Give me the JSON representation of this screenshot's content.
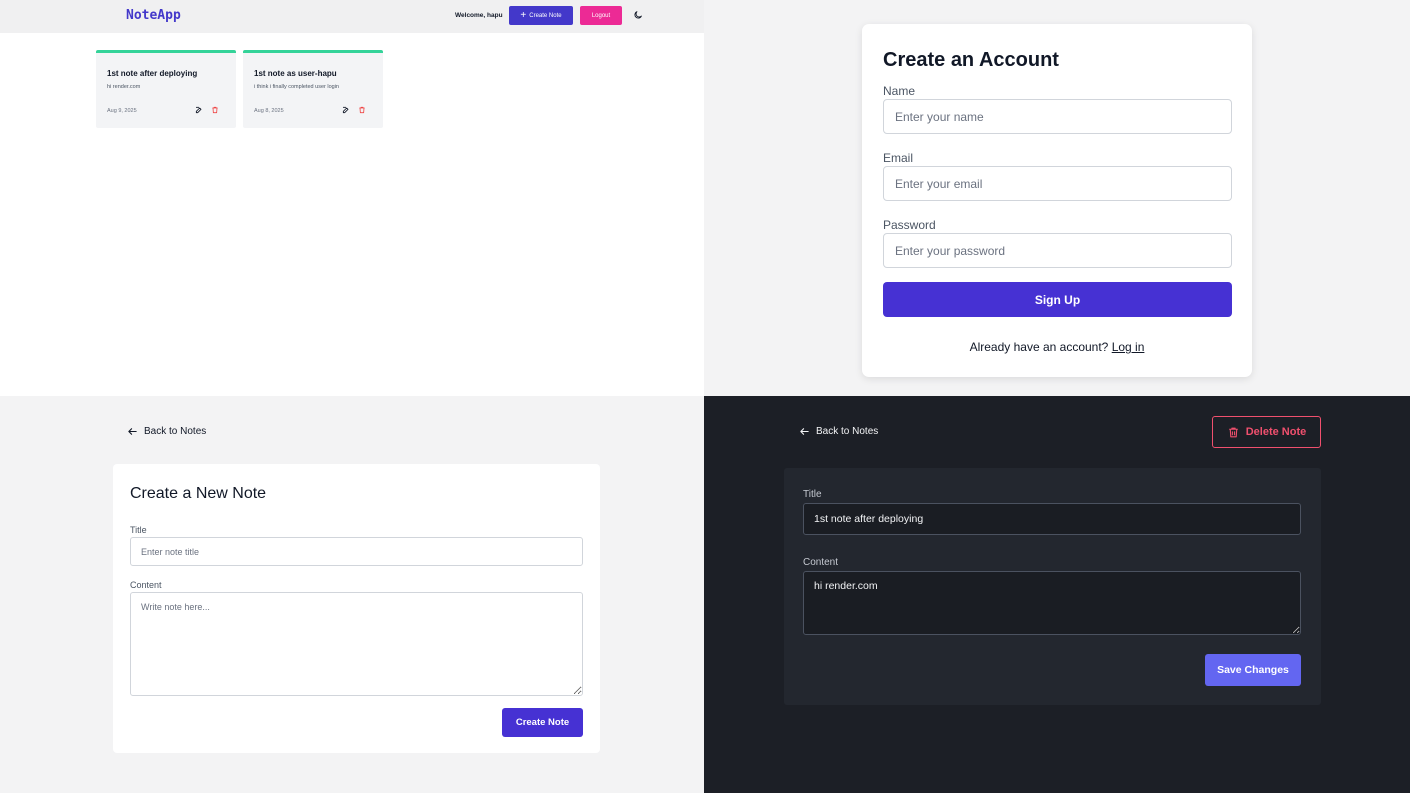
{
  "dashboard": {
    "brand": "NoteApp",
    "welcome": "Welcome, hapu",
    "create_note_label": "Create Note",
    "logout_label": "Logout",
    "notes": [
      {
        "title": "1st note after deploying",
        "content": "hi render.com",
        "date": "Aug 9, 2025"
      },
      {
        "title": "1st note as user-hapu",
        "content": "i think i finally completed user login",
        "date": "Aug 8, 2025"
      }
    ],
    "accent_color": "#34d399"
  },
  "signup": {
    "title": "Create an Account",
    "name_label": "Name",
    "name_placeholder": "Enter your name",
    "email_label": "Email",
    "email_placeholder": "Enter your email",
    "password_label": "Password",
    "password_placeholder": "Enter your password",
    "submit_label": "Sign Up",
    "footer_text": "Already have an account?",
    "login_link": "Log in"
  },
  "create_note": {
    "back_label": "Back to Notes",
    "title": "Create a New Note",
    "title_label": "Title",
    "title_placeholder": "Enter note title",
    "content_label": "Content",
    "content_placeholder": "Write note here...",
    "submit_label": "Create Note"
  },
  "edit_note": {
    "back_label": "Back to Notes",
    "delete_label": "Delete Note",
    "title_label": "Title",
    "title_value": "1st note after deploying",
    "content_label": "Content",
    "content_value": "hi render.com",
    "save_label": "Save Changes"
  },
  "colors": {
    "primary": "#4631d3",
    "brand_text": "#4338ca",
    "logout": "#ec2a95",
    "danger": "#f0506e",
    "dark_bg": "#1c1f26",
    "dark_card": "#23272f",
    "save": "#6366f1"
  }
}
